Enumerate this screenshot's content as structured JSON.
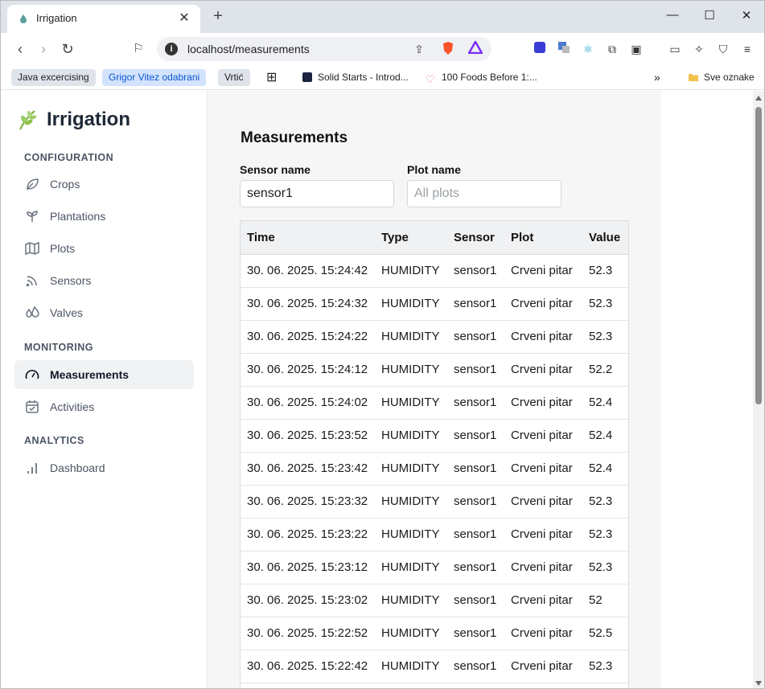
{
  "browser": {
    "tab_title": "Irrigation",
    "url": "localhost/measurements",
    "bookmarks": [
      {
        "label": "Java excercising"
      },
      {
        "label": "Grigor Vitez odabrani"
      },
      {
        "label": "Vrtić"
      },
      {
        "label": "Solid Starts - Introd..."
      },
      {
        "label": "100 Foods Before 1:..."
      }
    ],
    "overflow_label": "»",
    "all_bookmarks_label": "Sve oznake"
  },
  "sidebar": {
    "brand": "Irrigation",
    "sections": [
      {
        "label": "CONFIGURATION",
        "items": [
          {
            "label": "Crops",
            "icon": "leaf-icon"
          },
          {
            "label": "Plantations",
            "icon": "sprout-icon"
          },
          {
            "label": "Plots",
            "icon": "map-icon"
          },
          {
            "label": "Sensors",
            "icon": "rss-icon"
          },
          {
            "label": "Valves",
            "icon": "droplets-icon"
          }
        ]
      },
      {
        "label": "MONITORING",
        "items": [
          {
            "label": "Measurements",
            "icon": "gauge-icon",
            "active": true
          },
          {
            "label": "Activities",
            "icon": "calendar-check-icon"
          }
        ]
      },
      {
        "label": "ANALYTICS",
        "items": [
          {
            "label": "Dashboard",
            "icon": "bar-chart-icon"
          }
        ]
      }
    ]
  },
  "main": {
    "title": "Measurements",
    "filters": {
      "sensor_label": "Sensor name",
      "sensor_value": "sensor1",
      "plot_label": "Plot name",
      "plot_placeholder": "All plots"
    },
    "table": {
      "columns": [
        "Time",
        "Type",
        "Sensor",
        "Plot",
        "Value"
      ],
      "rows": [
        [
          "30. 06. 2025. 15:24:42",
          "HUMIDITY",
          "sensor1",
          "Crveni pitar",
          "52.3"
        ],
        [
          "30. 06. 2025. 15:24:32",
          "HUMIDITY",
          "sensor1",
          "Crveni pitar",
          "52.3"
        ],
        [
          "30. 06. 2025. 15:24:22",
          "HUMIDITY",
          "sensor1",
          "Crveni pitar",
          "52.3"
        ],
        [
          "30. 06. 2025. 15:24:12",
          "HUMIDITY",
          "sensor1",
          "Crveni pitar",
          "52.2"
        ],
        [
          "30. 06. 2025. 15:24:02",
          "HUMIDITY",
          "sensor1",
          "Crveni pitar",
          "52.4"
        ],
        [
          "30. 06. 2025. 15:23:52",
          "HUMIDITY",
          "sensor1",
          "Crveni pitar",
          "52.4"
        ],
        [
          "30. 06. 2025. 15:23:42",
          "HUMIDITY",
          "sensor1",
          "Crveni pitar",
          "52.4"
        ],
        [
          "30. 06. 2025. 15:23:32",
          "HUMIDITY",
          "sensor1",
          "Crveni pitar",
          "52.3"
        ],
        [
          "30. 06. 2025. 15:23:22",
          "HUMIDITY",
          "sensor1",
          "Crveni pitar",
          "52.3"
        ],
        [
          "30. 06. 2025. 15:23:12",
          "HUMIDITY",
          "sensor1",
          "Crveni pitar",
          "52.3"
        ],
        [
          "30. 06. 2025. 15:23:02",
          "HUMIDITY",
          "sensor1",
          "Crveni pitar",
          "52"
        ],
        [
          "30. 06. 2025. 15:22:52",
          "HUMIDITY",
          "sensor1",
          "Crveni pitar",
          "52.5"
        ],
        [
          "30. 06. 2025. 15:22:42",
          "HUMIDITY",
          "sensor1",
          "Crveni pitar",
          "52.3"
        ]
      ]
    }
  },
  "colors": {
    "brand_green": "#7cb342",
    "active_nav_bg": "#f1f2f4",
    "content_bg": "#f6f6f7"
  }
}
